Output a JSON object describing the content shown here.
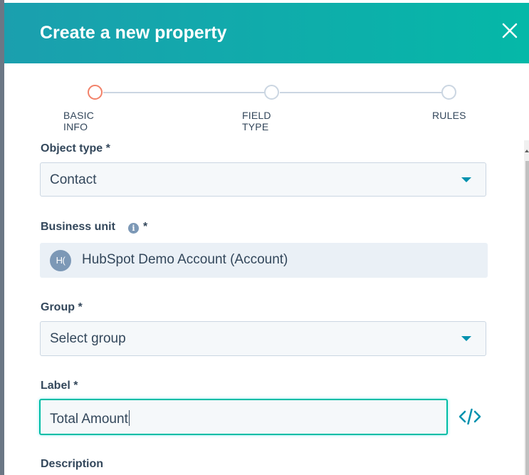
{
  "dialog": {
    "title": "Create a new property"
  },
  "steps": [
    {
      "label": "BASIC INFO",
      "state": "active"
    },
    {
      "label": "FIELD TYPE",
      "state": "inactive"
    },
    {
      "label": "RULES",
      "state": "inactive"
    }
  ],
  "form": {
    "object_type": {
      "label": "Object type *",
      "value": "Contact"
    },
    "business_unit": {
      "label": "Business unit",
      "required_mark": "*",
      "avatar_initials": "H(",
      "value": "HubSpot Demo Account (Account)"
    },
    "group": {
      "label": "Group *",
      "value": "Select group"
    },
    "label": {
      "label": "Label *",
      "value": "Total Amount"
    },
    "description": {
      "label": "Description"
    }
  },
  "icons": {
    "close": "close-icon",
    "info": "info-icon",
    "code": "code-icon",
    "dropdown": "chevron-down-icon"
  },
  "colors": {
    "header_start": "#1b9fae",
    "header_end": "#05b8a8",
    "active_step": "#f2826a",
    "focus_border": "#00bda5",
    "accent": "#0091ae"
  }
}
